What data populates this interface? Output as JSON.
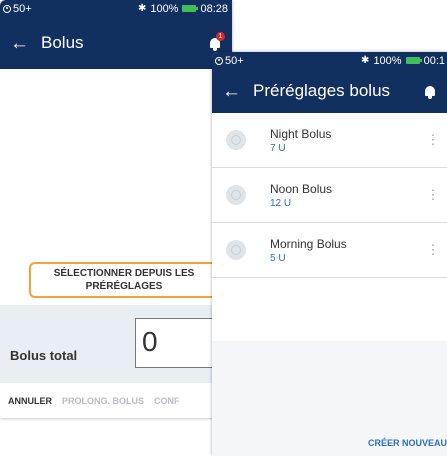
{
  "back_screen": {
    "status": {
      "left": "50+",
      "battery": "100%",
      "time": "08:28"
    },
    "title": "Bolus",
    "badge": "1",
    "preset_button": "SÉLECTIONNER DEPUIS LES PRÉRÉGLAGES",
    "bolus_total_label": "Bolus total",
    "bolus_value": "0",
    "buttons": {
      "cancel": "ANNULER",
      "extend": "PROLONG. BOLUS",
      "confirm": "CONF"
    }
  },
  "front_screen": {
    "status": {
      "left": "50+",
      "battery": "100%",
      "time": "00:1"
    },
    "title": "Préréglages bolus",
    "items": [
      {
        "name": "Night Bolus",
        "units": "7 U"
      },
      {
        "name": "Noon Bolus",
        "units": "12 U"
      },
      {
        "name": "Morning Bolus",
        "units": "5 U"
      }
    ],
    "create_button": "CRÉER NOUVEAU"
  }
}
